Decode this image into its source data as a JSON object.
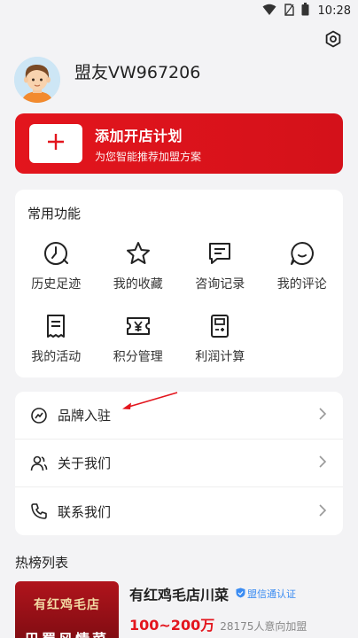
{
  "status_bar": {
    "time": "10:28",
    "icons": [
      "wifi-icon",
      "sim-icon",
      "battery-icon"
    ]
  },
  "header": {
    "settings_icon": "settings-icon"
  },
  "profile": {
    "username": "盟友VW967206",
    "avatar_icon": "avatar-icon"
  },
  "plan_card": {
    "title": "添加开店计划",
    "subtitle": "为您智能推荐加盟方案",
    "icon": "plus-icon",
    "color": "#e3151d"
  },
  "functions": {
    "title": "常用功能",
    "items": [
      {
        "label": "历史足迹",
        "icon": "history-icon"
      },
      {
        "label": "我的收藏",
        "icon": "star-icon"
      },
      {
        "label": "咨询记录",
        "icon": "message-icon"
      },
      {
        "label": "我的评论",
        "icon": "comment-icon"
      },
      {
        "label": "我的活动",
        "icon": "receipt-icon"
      },
      {
        "label": "积分管理",
        "icon": "points-icon"
      },
      {
        "label": "利润计算",
        "icon": "calculator-icon"
      }
    ]
  },
  "menu": {
    "items": [
      {
        "label": "品牌入驻",
        "icon": "brand-icon"
      },
      {
        "label": "关于我们",
        "icon": "people-icon"
      },
      {
        "label": "联系我们",
        "icon": "phone-icon"
      }
    ]
  },
  "hot_list": {
    "title": "热榜列表",
    "items": [
      {
        "thumb_title": "有红鸡毛店",
        "thumb_bottom": "巴蜀风情菜",
        "name": "有红鸡毛店川菜",
        "badge": "盟信通认证",
        "price": "100~200万",
        "count": "28175人意向加盟"
      }
    ]
  },
  "colors": {
    "accent": "#e3151d",
    "badge": "#3b8cf2"
  }
}
